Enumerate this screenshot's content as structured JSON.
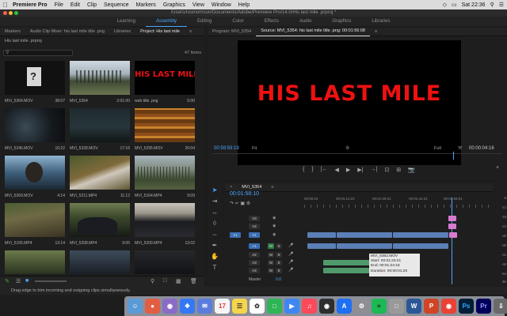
{
  "menubar": {
    "app_name": "Premiere Pro",
    "items": [
      "File",
      "Edit",
      "Clip",
      "Sequence",
      "Markers",
      "Graphics",
      "View",
      "Window",
      "Help"
    ],
    "time": "Sat 22:36"
  },
  "titlebar": {
    "path": "/Users/rosmorrison/Documents/Adobe/Premiere Pro/14.0/His last mile .prproj *"
  },
  "workspaces": {
    "items": [
      "Learning",
      "Assembly",
      "Editing",
      "Color",
      "Effects",
      "Audio",
      "Graphics",
      "Libraries"
    ],
    "active": "Assembly"
  },
  "left_panel": {
    "tabs": [
      "Markers",
      "Audio Clip Mixer: his last mile title .png",
      "Libraries",
      "Project: His last mile"
    ],
    "project_file": "His last mile .prproj",
    "item_count": "47 Items",
    "clips": [
      {
        "name": "MVI_5364.MOV",
        "duration": "38:07"
      },
      {
        "name": "MVI_5354",
        "duration": "2:01:00"
      },
      {
        "name": "web title .png",
        "duration": "5:00"
      },
      {
        "name": "MVI_5246.MOV",
        "duration": "10:22"
      },
      {
        "name": "MVI_5328.MOV",
        "duration": "17:16"
      },
      {
        "name": "MVI_5295.MOV",
        "duration": "20:04"
      },
      {
        "name": "MVI_5269.MOV",
        "duration": "4:14"
      },
      {
        "name": "MVI_5211.MP4",
        "duration": "11:12"
      },
      {
        "name": "MVI_5164.MP4",
        "duration": "9:09"
      },
      {
        "name": "MVI_5165.MP4",
        "duration": "13:14"
      },
      {
        "name": "MVI_5208.MP4",
        "duration": "9:05"
      },
      {
        "name": "MVI_5209.MP4",
        "duration": "13:02"
      }
    ],
    "title_card_text": "HIS LAST MILE"
  },
  "monitor": {
    "tabs": [
      "Program: MVI_5354",
      "Source: MVI_5354: his last mile title .png: 00:01:56:08"
    ],
    "screen_text": "HIS LAST MILE",
    "timecode": "00:59:59:19",
    "fit": "Fit",
    "resolution": "Full",
    "duration": "00:00:04:16",
    "controls": [
      "{",
      "}",
      "|←",
      "◀",
      "▶",
      "▶|",
      "→|",
      "⊡",
      "⊞",
      "📷"
    ]
  },
  "timeline": {
    "tab": "MVI_5354",
    "timecode": "00:01:58:10",
    "ticks": [
      "00:59:22",
      "00:01:14:22",
      "00:01:29:21",
      "00:01:44:21",
      "00:01:59:21"
    ],
    "tracks": [
      "V3",
      "V2",
      "V1",
      "A1",
      "A2",
      "A3",
      "A4"
    ],
    "master_label": "Master",
    "master_value": "0.0",
    "tooltip": {
      "name": "MVI_5362.MOV",
      "start": "Start: 00:01:23:21",
      "end": "End: 00:01:24:18",
      "duration": "Duration: 00:00:01:20"
    }
  },
  "meters": {
    "scale": [
      "-6",
      "-12",
      "-18",
      "-24",
      "-30",
      "-36",
      "-42",
      "-48",
      "-54"
    ],
    "bottom": "dB"
  },
  "status": {
    "text": "Drag edge to trim incoming and outgoing clips simultaneously."
  },
  "colors": {
    "accent": "#4aa6ff",
    "title_red": "#ee1111",
    "video_clip": "#5b7fb6",
    "title_clip": "#d77ad0",
    "audio_clip": "#4f9a6b"
  }
}
